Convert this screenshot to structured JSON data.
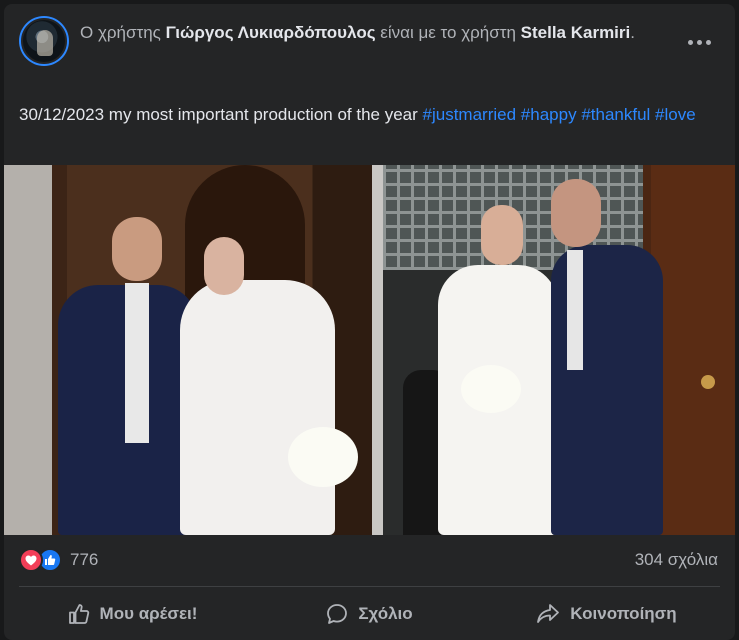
{
  "post": {
    "header": {
      "prefix": "Ο χρήστης ",
      "author": "Γιώργος Λυκιαρδόπουλος",
      "middle": " είναι με το χρήστη ",
      "tagged": "Stella Karmiri",
      "suffix": "."
    },
    "caption": {
      "text": "30/12/2023 my most important production of the year ",
      "hashtags": [
        "#justmarried",
        "#happy",
        "#thankful",
        "#love"
      ]
    },
    "icons": {
      "more": "more-options-icon",
      "heart": "love-reaction-icon",
      "like": "like-reaction-icon"
    }
  },
  "footer": {
    "reaction_count": "776",
    "comments": "304 σχόλια",
    "actions": {
      "like": "Μου αρέσει!",
      "comment": "Σχόλιο",
      "share": "Κοινοποίηση"
    }
  },
  "colors": {
    "card": "#242526",
    "text": "#e4e6eb",
    "secondary": "#b0b3b8",
    "link": "#2d88ff",
    "heart": "#f33e58",
    "like": "#1877f2"
  }
}
